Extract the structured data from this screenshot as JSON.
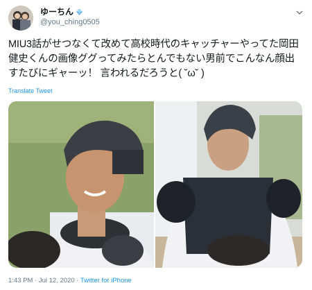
{
  "user": {
    "display_name": "ゆーちん",
    "handle": "@you_ching0505",
    "avatar_icon": "profile-photo",
    "verified_badge": "blue-diamond-icon"
  },
  "tweet": {
    "text": "MIU3話がせつなくて改めて高校時代のキャッチャーやってた岡田\n健史くんの画像ググってみたらとんでもない男前でこんなん顔出\nすたびにギャーッ！ 言われるだろうと( ˘ω˘ )",
    "translate_label": "Translate Tweet"
  },
  "media": {
    "photos": [
      "catcher-photo-1",
      "catcher-photo-2"
    ]
  },
  "meta": {
    "time": "1:43 PM",
    "separator1": " · ",
    "date": "Jul 12, 2020",
    "separator2": " · ",
    "source": "Twitter for iPhone"
  },
  "colors": {
    "link": "#1b95e0",
    "secondary": "#657786",
    "text": "#14171a"
  }
}
